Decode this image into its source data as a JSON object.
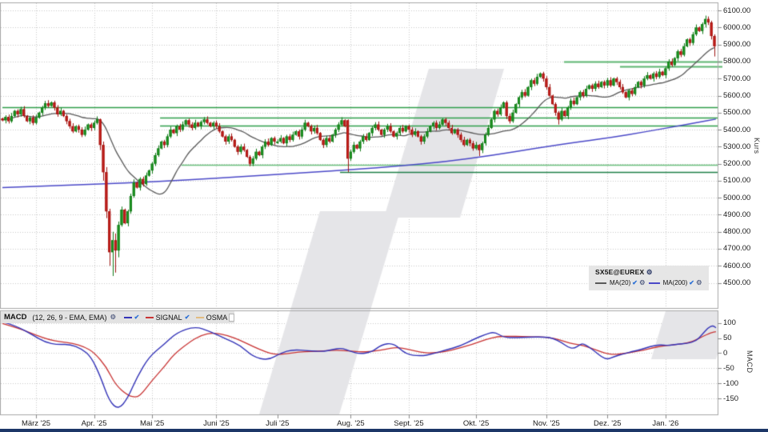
{
  "main_legend": {
    "instrument": "SX5E@EUREX",
    "ma20_label": "MA(20)",
    "ma200_label": "MA(200)"
  },
  "macd_legend": {
    "title": "MACD",
    "params": "(12, 26, 9 - EMA, EMA)",
    "signal_label": "SIGNAL",
    "osma_label": "OSMA",
    "macd_checked": true,
    "signal_checked": true,
    "osma_checked": false
  },
  "icons": {
    "check": "✔",
    "gear": "⚙"
  },
  "axes": {
    "kurs_label": "Kurs",
    "macd_label": "MACD",
    "price_ticks": [
      "6100.00",
      "6000.00",
      "5900.00",
      "5800.00",
      "5700.00",
      "5600.00",
      "5500.00",
      "5400.00",
      "5300.00",
      "5200.00",
      "5100.00",
      "5000.00",
      "4900.00",
      "4800.00",
      "4700.00",
      "4600.00",
      "4500.00"
    ],
    "macd_ticks": [
      "100",
      "50",
      "0",
      "-50",
      "-100",
      "-150"
    ],
    "date_ticks": [
      "März '25",
      "Apr. '25",
      "Mai '25",
      "Juni '25",
      "Juli '25",
      "Aug. '25",
      "Sept. '25",
      "Okt. '25",
      "Nov. '25",
      "Dez. '25",
      "Jan. '26"
    ]
  },
  "colors": {
    "up": "#23a127",
    "up_border": "#127a18",
    "down": "#d62420",
    "down_border": "#9e1411",
    "ma20": "#5a5a5a",
    "ma200": "#4b49c8",
    "macd_line": "#3434b8",
    "signal_line": "#c93434",
    "osma_swatch": "#e3bc7f",
    "grid": "#c9c9c9",
    "panel_border": "#a8a8a8",
    "watermark": "#e5e5e8"
  },
  "chart_data": {
    "type": "candlestick",
    "instrument": "SX5E@EUREX",
    "indicator": "MACD (12, 26, 9 - EMA, EMA)",
    "price_axis": {
      "label": "Kurs",
      "ticks": [
        6100,
        6000,
        5900,
        5800,
        5700,
        5600,
        5500,
        5400,
        5300,
        5200,
        5100,
        5000,
        4900,
        4800,
        4700,
        4600,
        4500
      ],
      "panel_max": 6143,
      "panel_min": 4352
    },
    "macd_axis": {
      "label": "MACD",
      "ticks": [
        100,
        50,
        0,
        -50,
        -100,
        -150
      ],
      "panel_max": 139,
      "panel_min": -203
    },
    "months": [
      {
        "label": "März '25",
        "i": 11
      },
      {
        "label": "Apr. '25",
        "i": 30
      },
      {
        "label": "Mai '25",
        "i": 49
      },
      {
        "label": "Juni '25",
        "i": 70
      },
      {
        "label": "Juli '25",
        "i": 90
      },
      {
        "label": "Aug. '25",
        "i": 114
      },
      {
        "label": "Sept. '25",
        "i": 133
      },
      {
        "label": "Okt. '25",
        "i": 155
      },
      {
        "label": "Nov. '25",
        "i": 178
      },
      {
        "label": "Dez. '25",
        "i": 198
      },
      {
        "label": "Jan. '26",
        "i": 217
      }
    ],
    "closes": [
      5455,
      5475,
      5450,
      5480,
      5510,
      5490,
      5520,
      5480,
      5450,
      5470,
      5440,
      5470,
      5500,
      5530,
      5555,
      5540,
      5560,
      5530,
      5490,
      5510,
      5480,
      5450,
      5420,
      5390,
      5420,
      5400,
      5370,
      5400,
      5430,
      5410,
      5440,
      5460,
      5310,
      5150,
      4920,
      4680,
      4750,
      4690,
      4840,
      4930,
      4850,
      4920,
      5010,
      5090,
      5060,
      5110,
      5080,
      5130,
      5160,
      5200,
      5250,
      5290,
      5330,
      5310,
      5360,
      5400,
      5380,
      5420,
      5400,
      5430,
      5455,
      5430,
      5410,
      5440,
      5420,
      5445,
      5460,
      5440,
      5420,
      5440,
      5420,
      5390,
      5360,
      5330,
      5360,
      5340,
      5300,
      5270,
      5300,
      5280,
      5240,
      5200,
      5230,
      5270,
      5250,
      5300,
      5330,
      5310,
      5350,
      5330,
      5330,
      5350,
      5320,
      5360,
      5340,
      5370,
      5390,
      5360,
      5400,
      5440,
      5420,
      5390,
      5410,
      5380,
      5340,
      5310,
      5350,
      5330,
      5370,
      5400,
      5430,
      5455,
      5420,
      5230,
      5270,
      5310,
      5290,
      5330,
      5360,
      5340,
      5380,
      5410,
      5430,
      5400,
      5370,
      5400,
      5420,
      5390,
      5360,
      5380,
      5410,
      5390,
      5420,
      5400,
      5370,
      5390,
      5360,
      5330,
      5360,
      5390,
      5420,
      5440,
      5410,
      5430,
      5460,
      5440,
      5410,
      5380,
      5400,
      5370,
      5340,
      5310,
      5340,
      5320,
      5290,
      5310,
      5280,
      5320,
      5370,
      5410,
      5460,
      5510,
      5490,
      5530,
      5560,
      5480,
      5450,
      5500,
      5550,
      5590,
      5620,
      5600,
      5650,
      5690,
      5670,
      5710,
      5730,
      5700,
      5650,
      5600,
      5550,
      5500,
      5460,
      5510,
      5480,
      5530,
      5570,
      5550,
      5590,
      5620,
      5600,
      5640,
      5660,
      5640,
      5670,
      5650,
      5680,
      5660,
      5690,
      5660,
      5700,
      5680,
      5650,
      5620,
      5590,
      5630,
      5610,
      5650,
      5680,
      5660,
      5700,
      5720,
      5700,
      5730,
      5710,
      5740,
      5720,
      5760,
      5800,
      5780,
      5820,
      5860,
      5840,
      5890,
      5930,
      5910,
      5960,
      6000,
      5980,
      6020,
      6050,
      6030,
      5950,
      5890
    ],
    "candle_overrides": {
      "32": [
        5460,
        5465,
        5280,
        5310
      ],
      "33": [
        5310,
        5330,
        5100,
        5150
      ],
      "34": [
        5150,
        5180,
        4880,
        4920
      ],
      "35": [
        4920,
        4935,
        4600,
        4680
      ],
      "36": [
        4680,
        4800,
        4540,
        4750
      ],
      "37": [
        4750,
        4790,
        4560,
        4690
      ],
      "38": [
        4690,
        4860,
        4650,
        4840
      ],
      "81": [
        5240,
        5250,
        5185,
        5200
      ],
      "113": [
        5455,
        5460,
        5150,
        5230
      ],
      "156": [
        5310,
        5315,
        5245,
        5280
      ],
      "182": [
        5500,
        5510,
        5430,
        5460
      ],
      "230": [
        6020,
        6070,
        6000,
        6050
      ],
      "231": [
        6050,
        6065,
        6015,
        6030
      ],
      "232": [
        6030,
        6040,
        5930,
        5950
      ],
      "233": [
        5950,
        5960,
        5830,
        5890
      ]
    },
    "ma20_window": 20,
    "ma200_points": [
      [
        0,
        5060
      ],
      [
        20,
        5072
      ],
      [
        40,
        5086
      ],
      [
        60,
        5104
      ],
      [
        80,
        5126
      ],
      [
        100,
        5148
      ],
      [
        115,
        5166
      ],
      [
        130,
        5186
      ],
      [
        145,
        5212
      ],
      [
        160,
        5248
      ],
      [
        175,
        5292
      ],
      [
        190,
        5332
      ],
      [
        200,
        5356
      ],
      [
        210,
        5386
      ],
      [
        220,
        5418
      ],
      [
        228,
        5444
      ],
      [
        233.5,
        5462
      ]
    ],
    "support_lines": [
      {
        "price": 5800,
        "from": 183.8,
        "overhang": true,
        "color": "#5cb570",
        "width": 2.2
      },
      {
        "price": 5772,
        "from": 202.1,
        "overhang": true,
        "color": "#5cb570",
        "width": 2.2
      },
      {
        "price": 5530,
        "from": 0,
        "overhang": false,
        "color": "#2f9e4a",
        "width": 1.4
      },
      {
        "price": 5470,
        "from": 51.6,
        "overhang": false,
        "color": "#2f9e4a",
        "width": 1.4
      },
      {
        "price": 5425,
        "from": 51.6,
        "overhang": false,
        "color": "#2f9e4a",
        "width": 1.4
      },
      {
        "price": 5195,
        "from": 58.6,
        "overhang": false,
        "color": "#6abf7c",
        "width": 1.6
      },
      {
        "price": 5150,
        "from": 110.5,
        "overhang": false,
        "color": "#1e7f48",
        "width": 1.4
      }
    ],
    "macd_points": [
      [
        0,
        105
      ],
      [
        5,
        88
      ],
      [
        10,
        60
      ],
      [
        14,
        36
      ],
      [
        18,
        28
      ],
      [
        22,
        30
      ],
      [
        26,
        14
      ],
      [
        29,
        -12
      ],
      [
        32,
        -75
      ],
      [
        35,
        -160
      ],
      [
        38,
        -187
      ],
      [
        41,
        -150
      ],
      [
        44,
        -80
      ],
      [
        48,
        -12
      ],
      [
        53,
        30
      ],
      [
        57,
        68
      ],
      [
        63,
        89
      ],
      [
        68,
        72
      ],
      [
        73,
        48
      ],
      [
        78,
        25
      ],
      [
        82,
        -12
      ],
      [
        87,
        -24
      ],
      [
        91,
        0
      ],
      [
        95,
        12
      ],
      [
        100,
        8
      ],
      [
        105,
        5
      ],
      [
        108,
        12
      ],
      [
        111,
        17
      ],
      [
        114,
        6
      ],
      [
        117,
        -3
      ],
      [
        121,
        4
      ],
      [
        124,
        28
      ],
      [
        128,
        34
      ],
      [
        132,
        -4
      ],
      [
        137,
        -10
      ],
      [
        141,
        -2
      ],
      [
        145,
        10
      ],
      [
        150,
        24
      ],
      [
        154,
        45
      ],
      [
        158,
        62
      ],
      [
        161,
        71
      ],
      [
        164,
        52
      ],
      [
        168,
        51
      ],
      [
        172,
        53
      ],
      [
        177,
        54
      ],
      [
        180,
        50
      ],
      [
        183,
        35
      ],
      [
        185,
        20
      ],
      [
        187,
        15
      ],
      [
        189,
        28
      ],
      [
        190,
        32
      ],
      [
        192,
        20
      ],
      [
        194,
        5
      ],
      [
        196,
        -12
      ],
      [
        198,
        -21
      ],
      [
        200,
        -12
      ],
      [
        203,
        -3
      ],
      [
        206,
        5
      ],
      [
        209,
        12
      ],
      [
        212,
        22
      ],
      [
        215,
        28
      ],
      [
        218,
        25
      ],
      [
        221,
        30
      ],
      [
        224,
        32
      ],
      [
        227,
        40
      ],
      [
        229,
        62
      ],
      [
        231,
        85
      ],
      [
        232.5,
        92
      ],
      [
        233.5,
        84
      ]
    ],
    "signal_points": [
      [
        0,
        98
      ],
      [
        6,
        80
      ],
      [
        11,
        60
      ],
      [
        15,
        45
      ],
      [
        19,
        38
      ],
      [
        23,
        33
      ],
      [
        27,
        20
      ],
      [
        30,
        2
      ],
      [
        34,
        -45
      ],
      [
        37,
        -105
      ],
      [
        41,
        -140
      ],
      [
        44,
        -148
      ],
      [
        46,
        -130
      ],
      [
        49,
        -90
      ],
      [
        53,
        -45
      ],
      [
        56,
        -5
      ],
      [
        61,
        35
      ],
      [
        65,
        60
      ],
      [
        69,
        68
      ],
      [
        74,
        58
      ],
      [
        78,
        42
      ],
      [
        82,
        22
      ],
      [
        86,
        5
      ],
      [
        89,
        -5
      ],
      [
        93,
        -2
      ],
      [
        97,
        4
      ],
      [
        101,
        6
      ],
      [
        105,
        7
      ],
      [
        109,
        10
      ],
      [
        113,
        8
      ],
      [
        117,
        4
      ],
      [
        121,
        5
      ],
      [
        125,
        12
      ],
      [
        129,
        20
      ],
      [
        133,
        12
      ],
      [
        137,
        3
      ],
      [
        140,
        0
      ],
      [
        145,
        5
      ],
      [
        149,
        15
      ],
      [
        154,
        30
      ],
      [
        158,
        45
      ],
      [
        162,
        55
      ],
      [
        166,
        56
      ],
      [
        170,
        55
      ],
      [
        174,
        54
      ],
      [
        177,
        54
      ],
      [
        181,
        48
      ],
      [
        184,
        38
      ],
      [
        187,
        30
      ],
      [
        190,
        26
      ],
      [
        194,
        12
      ],
      [
        197,
        0
      ],
      [
        200,
        -5
      ],
      [
        203,
        -2
      ],
      [
        206,
        3
      ],
      [
        210,
        10
      ],
      [
        213,
        18
      ],
      [
        216,
        24
      ],
      [
        219,
        27
      ],
      [
        222,
        30
      ],
      [
        226,
        38
      ],
      [
        229,
        55
      ],
      [
        232,
        68
      ],
      [
        233.5,
        71
      ]
    ]
  }
}
